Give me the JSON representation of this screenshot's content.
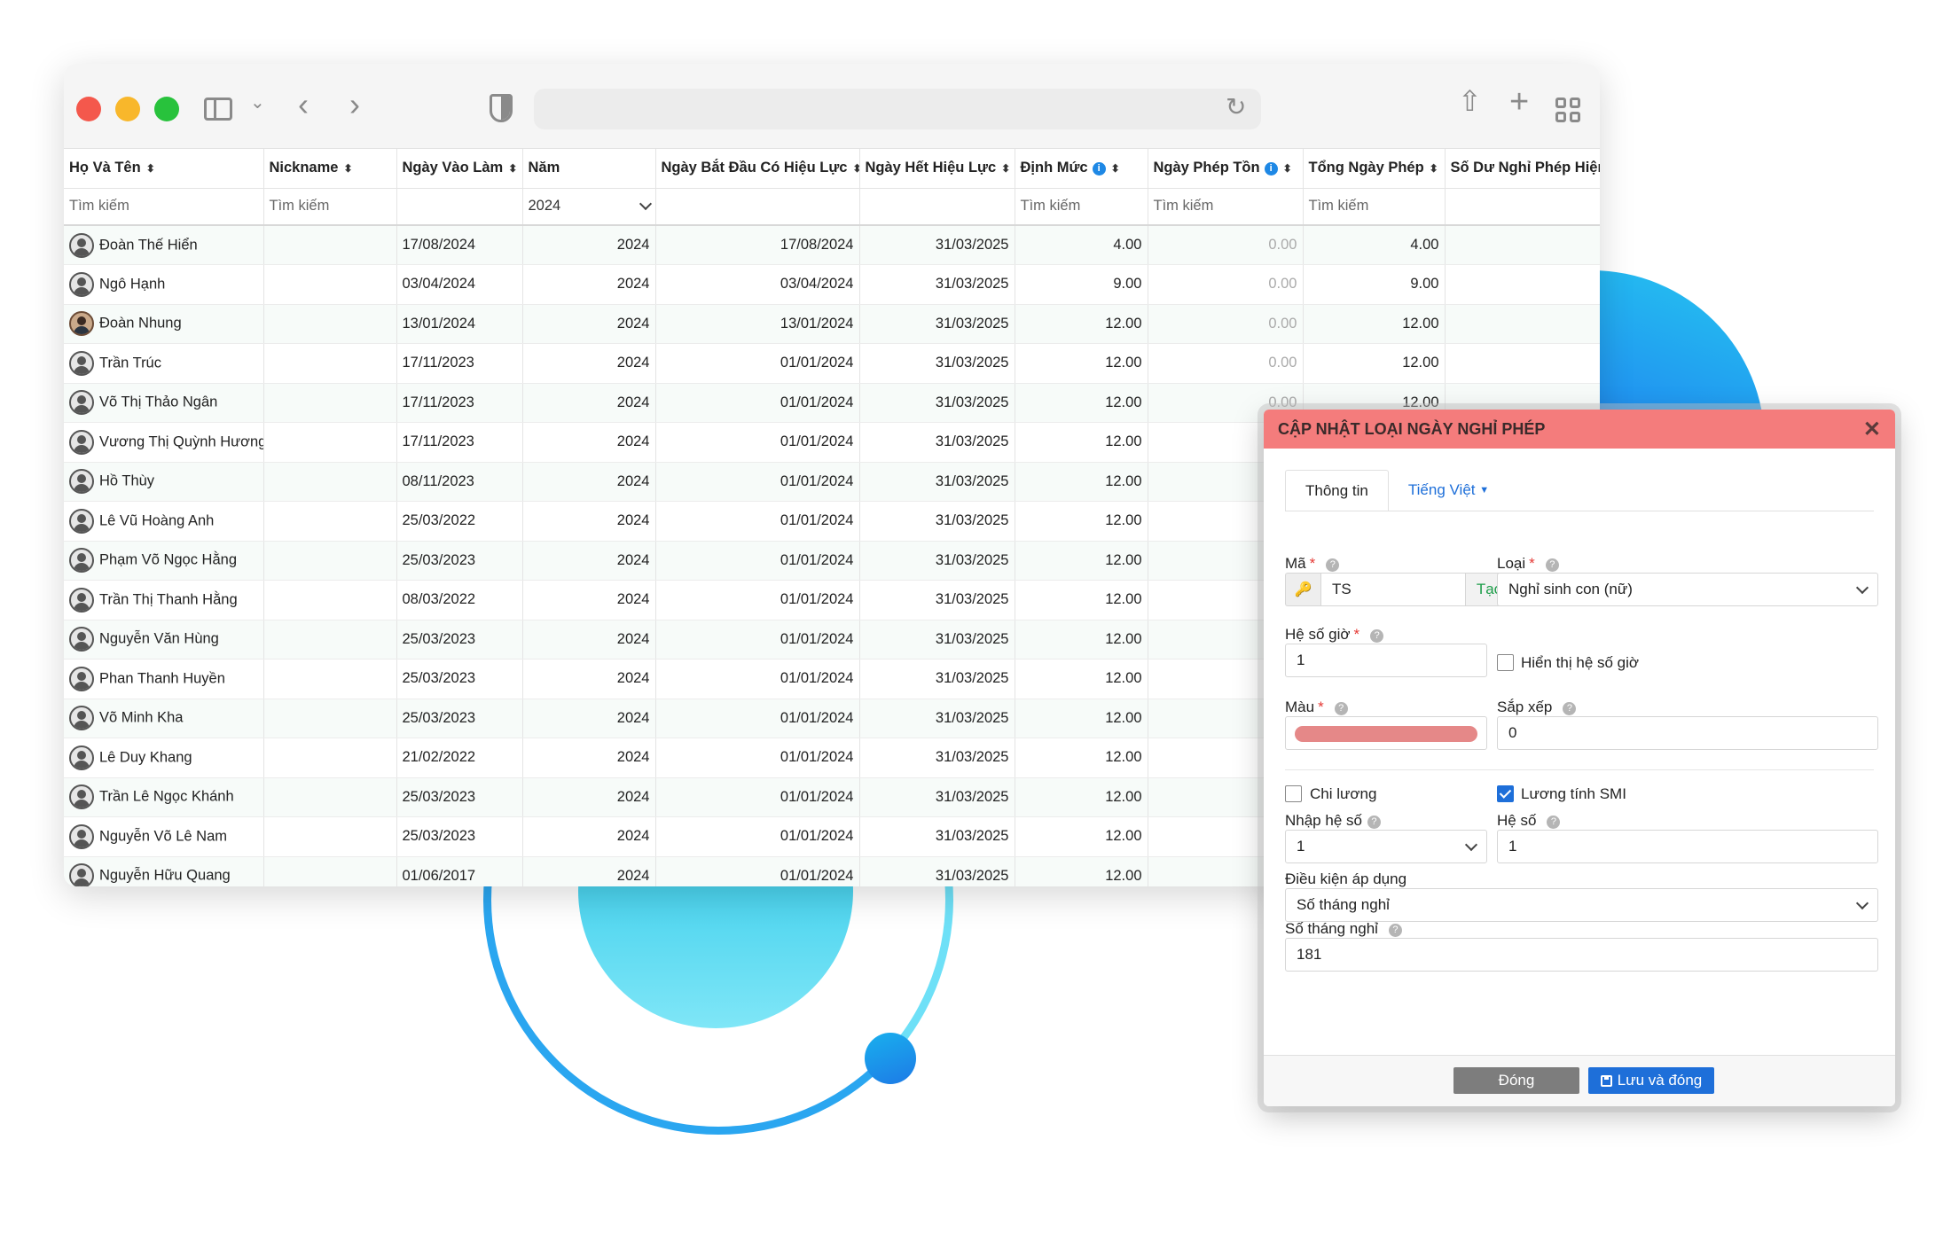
{
  "table": {
    "headers": {
      "name": "Họ Và Tên",
      "nickname": "Nickname",
      "start_date": "Ngày Vào Làm",
      "year": "Năm",
      "effective_from": "Ngày Bắt Đầu Có Hiệu Lực",
      "effective_to": "Ngày Hết Hiệu Lực",
      "quota": "Định Mức",
      "carryover": "Ngày Phép Tồn",
      "total": "Tổng Ngày Phép",
      "balance": "Số Dư Nghỉ Phép Hiện"
    },
    "filters": {
      "search": "Tìm kiếm",
      "year_value": "2024"
    },
    "rows": [
      {
        "name": "Đoàn Thế Hiển",
        "start": "17/08/2024",
        "year": "2024",
        "from": "17/08/2024",
        "to": "31/03/2025",
        "quota": "4.00",
        "carry": "0.00",
        "total": "4.00"
      },
      {
        "name": "Ngô Hạnh",
        "start": "03/04/2024",
        "year": "2024",
        "from": "03/04/2024",
        "to": "31/03/2025",
        "quota": "9.00",
        "carry": "0.00",
        "total": "9.00"
      },
      {
        "name": "Đoàn Nhung",
        "start": "13/01/2024",
        "year": "2024",
        "from": "13/01/2024",
        "to": "31/03/2025",
        "quota": "12.00",
        "carry": "0.00",
        "total": "12.00"
      },
      {
        "name": "Trần Trúc",
        "start": "17/11/2023",
        "year": "2024",
        "from": "01/01/2024",
        "to": "31/03/2025",
        "quota": "12.00",
        "carry": "0.00",
        "total": "12.00"
      },
      {
        "name": "Võ Thị Thảo Ngân",
        "start": "17/11/2023",
        "year": "2024",
        "from": "01/01/2024",
        "to": "31/03/2025",
        "quota": "12.00",
        "carry": "0.00",
        "total": "12.00"
      },
      {
        "name": "Vương Thị Quỳnh Hương",
        "start": "17/11/2023",
        "year": "2024",
        "from": "01/01/2024",
        "to": "31/03/2025",
        "quota": "12.00",
        "carry": "",
        "total": ""
      },
      {
        "name": "Hồ Thùy",
        "start": "08/11/2023",
        "year": "2024",
        "from": "01/01/2024",
        "to": "31/03/2025",
        "quota": "12.00",
        "carry": "",
        "total": ""
      },
      {
        "name": "Lê Vũ Hoàng Anh",
        "start": "25/03/2022",
        "year": "2024",
        "from": "01/01/2024",
        "to": "31/03/2025",
        "quota": "12.00",
        "carry": "",
        "total": ""
      },
      {
        "name": "Phạm Võ Ngọc Hằng",
        "start": "25/03/2023",
        "year": "2024",
        "from": "01/01/2024",
        "to": "31/03/2025",
        "quota": "12.00",
        "carry": "",
        "total": ""
      },
      {
        "name": "Trần Thị Thanh Hằng",
        "start": "08/03/2022",
        "year": "2024",
        "from": "01/01/2024",
        "to": "31/03/2025",
        "quota": "12.00",
        "carry": "",
        "total": ""
      },
      {
        "name": "Nguyễn Văn Hùng",
        "start": "25/03/2023",
        "year": "2024",
        "from": "01/01/2024",
        "to": "31/03/2025",
        "quota": "12.00",
        "carry": "",
        "total": ""
      },
      {
        "name": "Phan Thanh Huyền",
        "start": "25/03/2023",
        "year": "2024",
        "from": "01/01/2024",
        "to": "31/03/2025",
        "quota": "12.00",
        "carry": "",
        "total": ""
      },
      {
        "name": "Võ Minh Kha",
        "start": "25/03/2023",
        "year": "2024",
        "from": "01/01/2024",
        "to": "31/03/2025",
        "quota": "12.00",
        "carry": "",
        "total": ""
      },
      {
        "name": "Lê Duy Khang",
        "start": "21/02/2022",
        "year": "2024",
        "from": "01/01/2024",
        "to": "31/03/2025",
        "quota": "12.00",
        "carry": "",
        "total": ""
      },
      {
        "name": "Trần Lê Ngọc Khánh",
        "start": "25/03/2023",
        "year": "2024",
        "from": "01/01/2024",
        "to": "31/03/2025",
        "quota": "12.00",
        "carry": "",
        "total": ""
      },
      {
        "name": "Nguyễn Võ Lê Nam",
        "start": "25/03/2023",
        "year": "2024",
        "from": "01/01/2024",
        "to": "31/03/2025",
        "quota": "12.00",
        "carry": "",
        "total": ""
      },
      {
        "name": "Nguyễn Hữu Quang",
        "start": "01/06/2017",
        "year": "2024",
        "from": "01/01/2024",
        "to": "31/03/2025",
        "quota": "12.00",
        "carry": "",
        "total": ""
      }
    ]
  },
  "dialog": {
    "title": "CẬP NHẬT LOẠI NGÀY NGHỈ PHÉP",
    "tabs": {
      "info": "Thông tin",
      "language": "Tiếng Việt"
    },
    "code": {
      "label": "Mã",
      "value": "TS",
      "generate": "Tạo"
    },
    "type": {
      "label": "Loại",
      "value": "Nghỉ sinh con (nữ)"
    },
    "hour_factor": {
      "label": "Hệ số giờ",
      "value": "1",
      "show_label": "Hiển thị hệ số giờ",
      "show_checked": false
    },
    "color": {
      "label": "Màu",
      "value": "#e58888"
    },
    "order": {
      "label": "Sắp xếp",
      "value": "0"
    },
    "pay": {
      "label": "Chi lương",
      "checked": false
    },
    "smi": {
      "label": "Lương tính SMI",
      "checked": true
    },
    "input_factor": {
      "label": "Nhập hệ số",
      "value": "1"
    },
    "factor": {
      "label": "Hệ số",
      "value": "1"
    },
    "condition": {
      "label": "Điều kiện áp dụng",
      "value": "Số tháng nghỉ"
    },
    "months": {
      "label": "Số tháng nghỉ",
      "value": "181"
    },
    "buttons": {
      "close": "Đóng",
      "save": "Lưu và đóng"
    }
  },
  "colors": {
    "header_red": "#f47c7c",
    "primary_blue": "#1e6fd9",
    "accent_green": "#1e9e4a"
  }
}
